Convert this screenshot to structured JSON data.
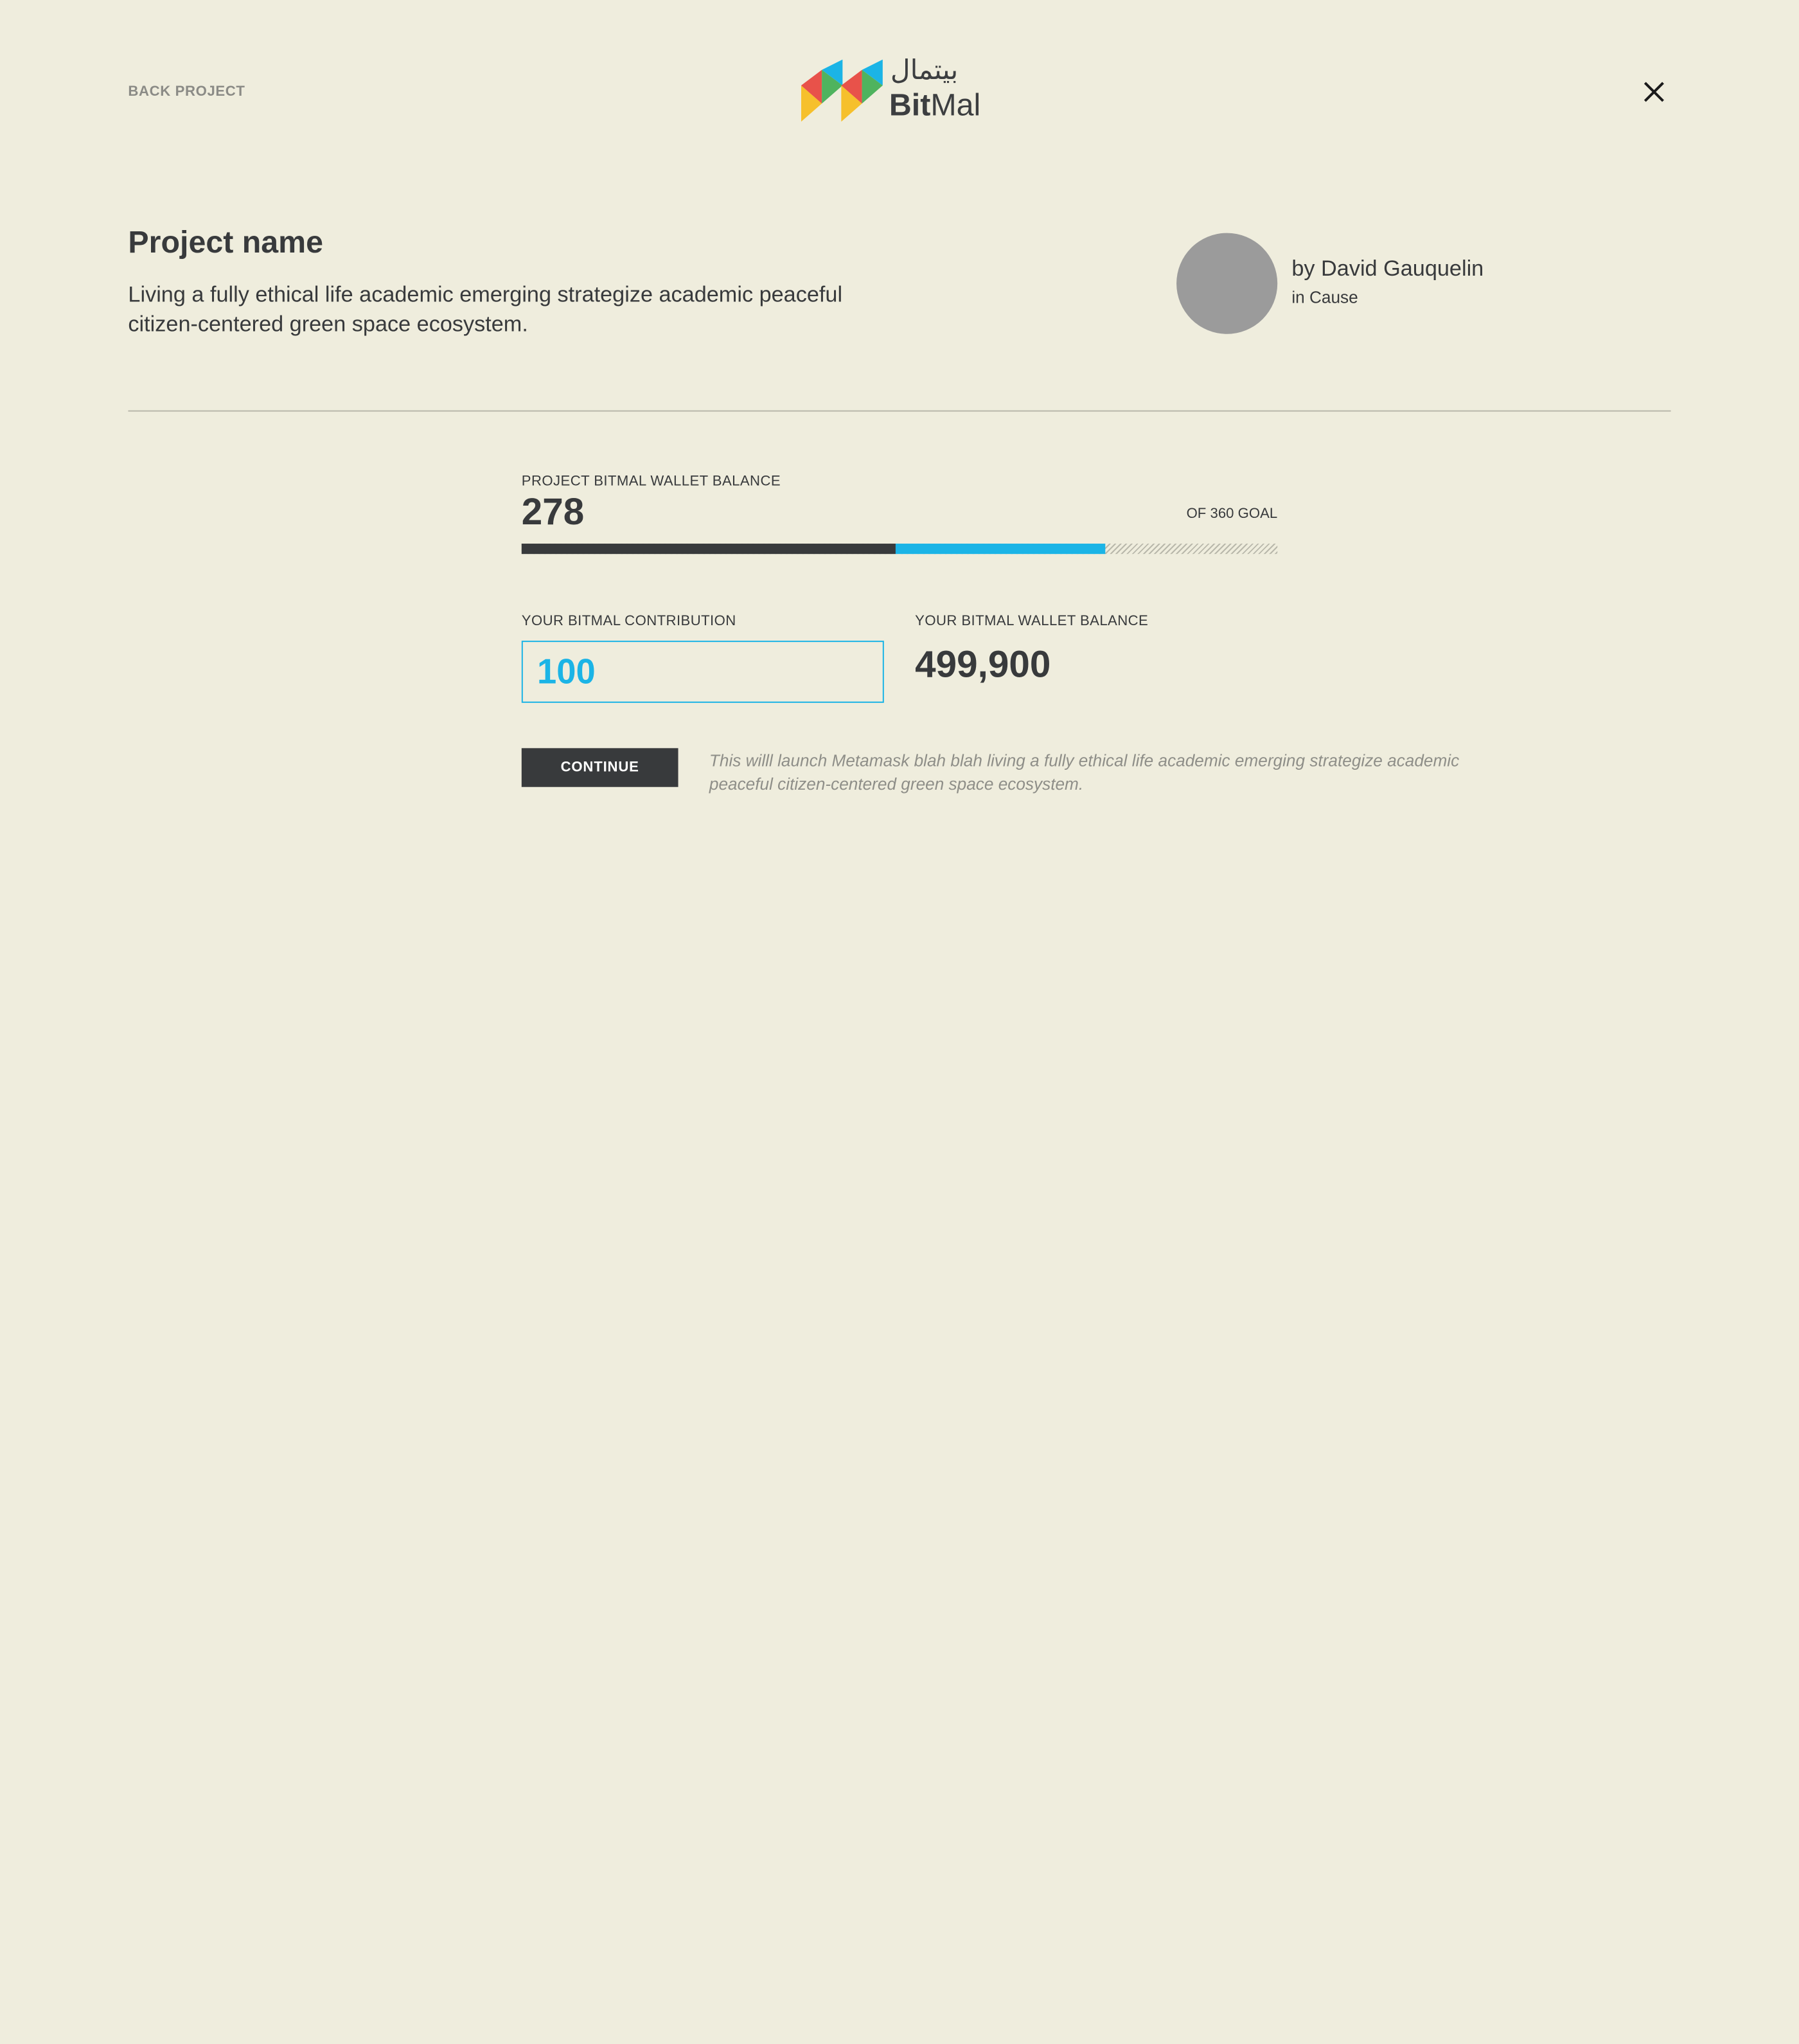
{
  "header": {
    "back_label": "BACK PROJECT",
    "logo": {
      "arabic": "بيتمال",
      "latin_bold": "Bit",
      "latin_regular": "Mal",
      "colors": [
        "#f6c02c",
        "#e8524a",
        "#1bb4e6",
        "#4fb35e"
      ]
    },
    "close_icon": "close-icon"
  },
  "project": {
    "title": "Project name",
    "description": "Living a fully ethical life academic emerging strategize academic peaceful citizen-centered green space ecosystem.",
    "author": "by David Gauquelin",
    "category": "in Cause"
  },
  "balance": {
    "label": "PROJECT BITMAL WALLET BALANCE",
    "value": "278",
    "goal_text": "OF 360 GOAL",
    "progress": {
      "current": 178,
      "pending": 100,
      "goal": 360
    },
    "colors": {
      "current": "#383a3c",
      "pending": "#1bb4e6"
    }
  },
  "contribution": {
    "label": "YOUR BITMAL CONTRIBUTION",
    "value": "100"
  },
  "wallet": {
    "label": "YOUR BITMAL WALLET BALANCE",
    "value": "499,900"
  },
  "actions": {
    "continue_label": "CONTINUE",
    "hint": "This willl launch Metamask blah blah living a fully ethical life academic emerging strategize academic peaceful citizen-centered green space ecosystem."
  }
}
